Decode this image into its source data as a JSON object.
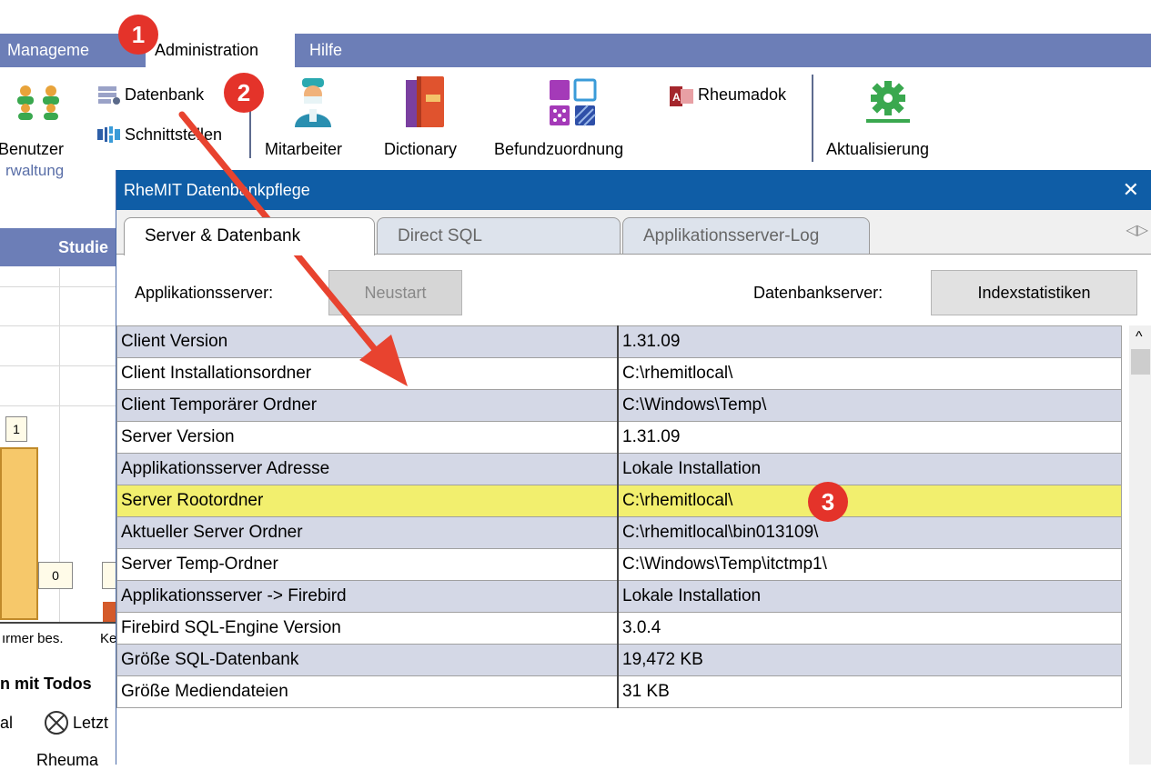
{
  "menu": {
    "tabs": [
      {
        "label": "Manageme",
        "active": false
      },
      {
        "label": "Administration",
        "active": true
      },
      {
        "label": "Hilfe",
        "active": false
      }
    ]
  },
  "ribbon": {
    "benutzer_label": "Benutzer",
    "verwaltung_label": "rwaltung",
    "datenbank_label": "Datenbank",
    "schnittstellen_label": "Schnittstellen",
    "mitarbeiter_label": "Mitarbeiter",
    "dictionary_label": "Dictionary",
    "befundzuordnung_label": "Befundzuordnung",
    "rheumadok_label": "Rheumadok",
    "aktualisierung_label": "Aktualisierung"
  },
  "background": {
    "studie_header": "Studie",
    "bar_label_1": "1",
    "bar_label_0": "0",
    "axis_label_1": "ırmer bes.",
    "axis_label_2": "Ke",
    "todos_header": "n mit Todos",
    "toolbar_left": "al",
    "toolbar_letzt": "Letzt",
    "bottom_text": "Rheuma"
  },
  "dialog": {
    "title": "RheMIT Datenbankpflege",
    "close_glyph": "✕",
    "tabs": [
      {
        "label": "Server & Datenbank",
        "active": true
      },
      {
        "label": "Direct SQL",
        "active": false
      },
      {
        "label": "Applikationsserver-Log",
        "active": false
      }
    ],
    "tab_nav_glyph": "◁▷",
    "app_server_label": "Applikationsserver:",
    "restart_label": "Neustart",
    "db_server_label": "Datenbankserver:",
    "index_stats_label": "Indexstatistiken",
    "scroll_up_glyph": "^",
    "rows": [
      {
        "key": "Client Version",
        "value": "1.31.09"
      },
      {
        "key": "Client Installationsordner",
        "value": "C:\\rhemitlocal\\"
      },
      {
        "key": "Client Temporärer Ordner",
        "value": "C:\\Windows\\Temp\\"
      },
      {
        "key": "Server Version",
        "value": "1.31.09"
      },
      {
        "key": "Applikationsserver Adresse",
        "value": "Lokale Installation"
      },
      {
        "key": "Server Rootordner",
        "value": "C:\\rhemitlocal\\",
        "highlight": true
      },
      {
        "key": "Aktueller Server Ordner",
        "value": "C:\\rhemitlocal\\bin013109\\"
      },
      {
        "key": "Server Temp-Ordner",
        "value": "C:\\Windows\\Temp\\itctmp1\\"
      },
      {
        "key": "Applikationsserver -> Firebird",
        "value": "Lokale Installation"
      },
      {
        "key": "Firebird SQL-Engine Version",
        "value": "3.0.4"
      },
      {
        "key": "Größe SQL-Datenbank",
        "value": "19,472 KB"
      },
      {
        "key": "Größe Mediendateien",
        "value": "31 KB"
      }
    ]
  },
  "annotations": {
    "marker1": "1",
    "marker2": "2",
    "marker3": "3",
    "arrow_color": "#e8432f",
    "highlight_color": "#f2ef6e"
  }
}
